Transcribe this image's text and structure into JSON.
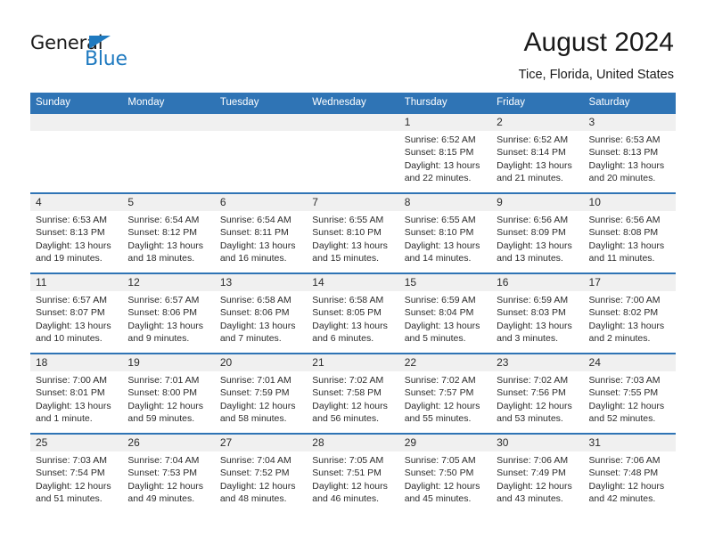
{
  "brand": {
    "word_one": "General",
    "word_two": "Blue",
    "triangle_icon": "brand-triangle-icon",
    "accent_color": "#1f7ac0"
  },
  "header": {
    "title": "August 2024",
    "subtitle": "Tice, Florida, United States"
  },
  "theme": {
    "header_blue": "#2f74b5",
    "daynum_strip": "#f0f0f0",
    "text": "#2b2b2b"
  },
  "weekdays": [
    "Sunday",
    "Monday",
    "Tuesday",
    "Wednesday",
    "Thursday",
    "Friday",
    "Saturday"
  ],
  "weeks": [
    {
      "days": [
        {
          "num": "",
          "sunrise": "",
          "sunset": "",
          "daylight_line1": "",
          "daylight_line2": ""
        },
        {
          "num": "",
          "sunrise": "",
          "sunset": "",
          "daylight_line1": "",
          "daylight_line2": ""
        },
        {
          "num": "",
          "sunrise": "",
          "sunset": "",
          "daylight_line1": "",
          "daylight_line2": ""
        },
        {
          "num": "",
          "sunrise": "",
          "sunset": "",
          "daylight_line1": "",
          "daylight_line2": ""
        },
        {
          "num": "1",
          "sunrise": "Sunrise: 6:52 AM",
          "sunset": "Sunset: 8:15 PM",
          "daylight_line1": "Daylight: 13 hours",
          "daylight_line2": "and 22 minutes."
        },
        {
          "num": "2",
          "sunrise": "Sunrise: 6:52 AM",
          "sunset": "Sunset: 8:14 PM",
          "daylight_line1": "Daylight: 13 hours",
          "daylight_line2": "and 21 minutes."
        },
        {
          "num": "3",
          "sunrise": "Sunrise: 6:53 AM",
          "sunset": "Sunset: 8:13 PM",
          "daylight_line1": "Daylight: 13 hours",
          "daylight_line2": "and 20 minutes."
        }
      ]
    },
    {
      "days": [
        {
          "num": "4",
          "sunrise": "Sunrise: 6:53 AM",
          "sunset": "Sunset: 8:13 PM",
          "daylight_line1": "Daylight: 13 hours",
          "daylight_line2": "and 19 minutes."
        },
        {
          "num": "5",
          "sunrise": "Sunrise: 6:54 AM",
          "sunset": "Sunset: 8:12 PM",
          "daylight_line1": "Daylight: 13 hours",
          "daylight_line2": "and 18 minutes."
        },
        {
          "num": "6",
          "sunrise": "Sunrise: 6:54 AM",
          "sunset": "Sunset: 8:11 PM",
          "daylight_line1": "Daylight: 13 hours",
          "daylight_line2": "and 16 minutes."
        },
        {
          "num": "7",
          "sunrise": "Sunrise: 6:55 AM",
          "sunset": "Sunset: 8:10 PM",
          "daylight_line1": "Daylight: 13 hours",
          "daylight_line2": "and 15 minutes."
        },
        {
          "num": "8",
          "sunrise": "Sunrise: 6:55 AM",
          "sunset": "Sunset: 8:10 PM",
          "daylight_line1": "Daylight: 13 hours",
          "daylight_line2": "and 14 minutes."
        },
        {
          "num": "9",
          "sunrise": "Sunrise: 6:56 AM",
          "sunset": "Sunset: 8:09 PM",
          "daylight_line1": "Daylight: 13 hours",
          "daylight_line2": "and 13 minutes."
        },
        {
          "num": "10",
          "sunrise": "Sunrise: 6:56 AM",
          "sunset": "Sunset: 8:08 PM",
          "daylight_line1": "Daylight: 13 hours",
          "daylight_line2": "and 11 minutes."
        }
      ]
    },
    {
      "days": [
        {
          "num": "11",
          "sunrise": "Sunrise: 6:57 AM",
          "sunset": "Sunset: 8:07 PM",
          "daylight_line1": "Daylight: 13 hours",
          "daylight_line2": "and 10 minutes."
        },
        {
          "num": "12",
          "sunrise": "Sunrise: 6:57 AM",
          "sunset": "Sunset: 8:06 PM",
          "daylight_line1": "Daylight: 13 hours",
          "daylight_line2": "and 9 minutes."
        },
        {
          "num": "13",
          "sunrise": "Sunrise: 6:58 AM",
          "sunset": "Sunset: 8:06 PM",
          "daylight_line1": "Daylight: 13 hours",
          "daylight_line2": "and 7 minutes."
        },
        {
          "num": "14",
          "sunrise": "Sunrise: 6:58 AM",
          "sunset": "Sunset: 8:05 PM",
          "daylight_line1": "Daylight: 13 hours",
          "daylight_line2": "and 6 minutes."
        },
        {
          "num": "15",
          "sunrise": "Sunrise: 6:59 AM",
          "sunset": "Sunset: 8:04 PM",
          "daylight_line1": "Daylight: 13 hours",
          "daylight_line2": "and 5 minutes."
        },
        {
          "num": "16",
          "sunrise": "Sunrise: 6:59 AM",
          "sunset": "Sunset: 8:03 PM",
          "daylight_line1": "Daylight: 13 hours",
          "daylight_line2": "and 3 minutes."
        },
        {
          "num": "17",
          "sunrise": "Sunrise: 7:00 AM",
          "sunset": "Sunset: 8:02 PM",
          "daylight_line1": "Daylight: 13 hours",
          "daylight_line2": "and 2 minutes."
        }
      ]
    },
    {
      "days": [
        {
          "num": "18",
          "sunrise": "Sunrise: 7:00 AM",
          "sunset": "Sunset: 8:01 PM",
          "daylight_line1": "Daylight: 13 hours",
          "daylight_line2": "and 1 minute."
        },
        {
          "num": "19",
          "sunrise": "Sunrise: 7:01 AM",
          "sunset": "Sunset: 8:00 PM",
          "daylight_line1": "Daylight: 12 hours",
          "daylight_line2": "and 59 minutes."
        },
        {
          "num": "20",
          "sunrise": "Sunrise: 7:01 AM",
          "sunset": "Sunset: 7:59 PM",
          "daylight_line1": "Daylight: 12 hours",
          "daylight_line2": "and 58 minutes."
        },
        {
          "num": "21",
          "sunrise": "Sunrise: 7:02 AM",
          "sunset": "Sunset: 7:58 PM",
          "daylight_line1": "Daylight: 12 hours",
          "daylight_line2": "and 56 minutes."
        },
        {
          "num": "22",
          "sunrise": "Sunrise: 7:02 AM",
          "sunset": "Sunset: 7:57 PM",
          "daylight_line1": "Daylight: 12 hours",
          "daylight_line2": "and 55 minutes."
        },
        {
          "num": "23",
          "sunrise": "Sunrise: 7:02 AM",
          "sunset": "Sunset: 7:56 PM",
          "daylight_line1": "Daylight: 12 hours",
          "daylight_line2": "and 53 minutes."
        },
        {
          "num": "24",
          "sunrise": "Sunrise: 7:03 AM",
          "sunset": "Sunset: 7:55 PM",
          "daylight_line1": "Daylight: 12 hours",
          "daylight_line2": "and 52 minutes."
        }
      ]
    },
    {
      "days": [
        {
          "num": "25",
          "sunrise": "Sunrise: 7:03 AM",
          "sunset": "Sunset: 7:54 PM",
          "daylight_line1": "Daylight: 12 hours",
          "daylight_line2": "and 51 minutes."
        },
        {
          "num": "26",
          "sunrise": "Sunrise: 7:04 AM",
          "sunset": "Sunset: 7:53 PM",
          "daylight_line1": "Daylight: 12 hours",
          "daylight_line2": "and 49 minutes."
        },
        {
          "num": "27",
          "sunrise": "Sunrise: 7:04 AM",
          "sunset": "Sunset: 7:52 PM",
          "daylight_line1": "Daylight: 12 hours",
          "daylight_line2": "and 48 minutes."
        },
        {
          "num": "28",
          "sunrise": "Sunrise: 7:05 AM",
          "sunset": "Sunset: 7:51 PM",
          "daylight_line1": "Daylight: 12 hours",
          "daylight_line2": "and 46 minutes."
        },
        {
          "num": "29",
          "sunrise": "Sunrise: 7:05 AM",
          "sunset": "Sunset: 7:50 PM",
          "daylight_line1": "Daylight: 12 hours",
          "daylight_line2": "and 45 minutes."
        },
        {
          "num": "30",
          "sunrise": "Sunrise: 7:06 AM",
          "sunset": "Sunset: 7:49 PM",
          "daylight_line1": "Daylight: 12 hours",
          "daylight_line2": "and 43 minutes."
        },
        {
          "num": "31",
          "sunrise": "Sunrise: 7:06 AM",
          "sunset": "Sunset: 7:48 PM",
          "daylight_line1": "Daylight: 12 hours",
          "daylight_line2": "and 42 minutes."
        }
      ]
    }
  ]
}
